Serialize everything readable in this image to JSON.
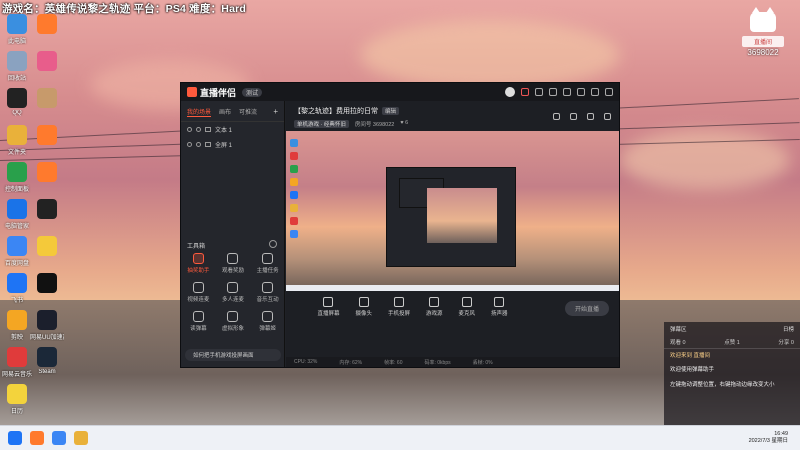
{
  "overlay": {
    "title": "游戏名：英雄传说黎之轨迹 平台：PS4 难度：Hard"
  },
  "watermark": {
    "room_label": "直播间",
    "room_id": "3698022"
  },
  "desktop_icons": [
    {
      "label": "此电脑",
      "color": "#3a8fe0"
    },
    {
      "label": "回收站",
      "color": "#8aa2c0"
    },
    {
      "label": "QQ",
      "color": "#222"
    },
    {
      "label": "文件夹",
      "color": "#e9b13a"
    },
    {
      "label": "控制面板",
      "color": "#29a04b"
    },
    {
      "label": "电脑管家",
      "color": "#1a73e8"
    },
    {
      "label": "百度网盘",
      "color": "#3b86f4"
    },
    {
      "label": "飞书",
      "color": "#1e74f5"
    },
    {
      "label": "剪映",
      "color": "#f4a623"
    },
    {
      "label": "网易云音乐",
      "color": "#e03b3b"
    },
    {
      "label": "日历",
      "color": "#f3d33c"
    }
  ],
  "desktop_icons2": [
    {
      "label": "",
      "color": "#ff7a2d"
    },
    {
      "label": "",
      "color": "#e85d8b"
    },
    {
      "label": "",
      "color": "#c79a6b"
    },
    {
      "label": "",
      "color": "#ff7a2d"
    },
    {
      "label": "",
      "color": "#ff7a2d"
    },
    {
      "label": "",
      "color": "#222"
    },
    {
      "label": "",
      "color": "#f4c93a"
    },
    {
      "label": "",
      "color": "#111"
    },
    {
      "label": "网易UU加速器",
      "color": "#1b1f2c"
    },
    {
      "label": "Steam",
      "color": "#1b2838"
    }
  ],
  "app": {
    "name": "直播伴侣",
    "version": "测试",
    "left_tabs": [
      "我的场景",
      "画布",
      "可推流"
    ],
    "scenes": [
      "文本 1",
      "全屏 1"
    ],
    "tools_title": "工具箱",
    "tools": [
      {
        "label": "抽奖助手",
        "hot": true
      },
      {
        "label": "观看奖励",
        "hot": false
      },
      {
        "label": "主播任务",
        "hot": false
      },
      {
        "label": "视频连麦",
        "hot": false
      },
      {
        "label": "多人连麦",
        "hot": false
      },
      {
        "label": "音乐互动",
        "hot": false
      },
      {
        "label": "读弹幕",
        "hot": false
      },
      {
        "label": "虚拟形象",
        "hot": false
      },
      {
        "label": "弹幕姬",
        "hot": false
      }
    ],
    "footer_tip": "如何把手机游戏投屏画面",
    "main_title": "【黎之轨迹】费用拉的日常",
    "edit_label": "编辑",
    "sub_tags": [
      "单机游戏 · 经典怀旧",
      "房间号 3698022",
      "♥ 6"
    ],
    "actions": [
      "直播屏幕",
      "摄像头",
      "手机投屏",
      "游戏源",
      "麦克风",
      "扬声器"
    ],
    "start_label": "开始直播",
    "status": [
      "CPU: 32%",
      "内存: 62%",
      "帧率: 60",
      "码率: 0kbps",
      "丢帧: 0%"
    ]
  },
  "chat": {
    "tabs": [
      "弹幕区",
      "日榜"
    ],
    "stats": [
      "观看 0",
      "点赞 1",
      "分享 0"
    ],
    "messages": [
      {
        "text": "欢迎来到 直播间",
        "sys": true
      },
      {
        "text": "欢迎使用弹幕助手",
        "sys": false
      },
      {
        "text": "左键拖动调整位置，右键拖动边缘改变大小",
        "sys": false
      }
    ]
  },
  "taskbar": {
    "time": "16:49",
    "date": "2022/7/3 星期日"
  }
}
